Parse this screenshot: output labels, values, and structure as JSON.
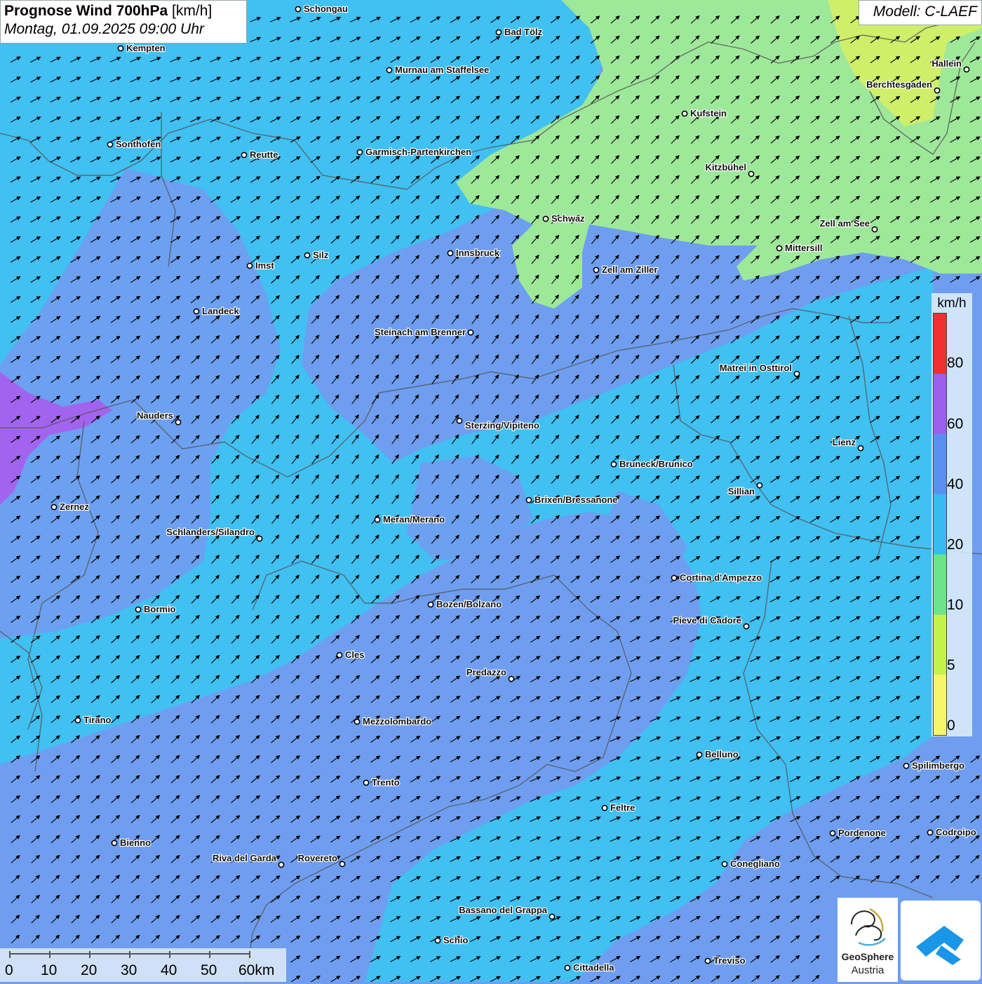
{
  "header": {
    "title_bold": "Prognose Wind 700hPa",
    "title_unit": " [km/h]",
    "datetime": "Montag, 01.09.2025 09:00 Uhr"
  },
  "model_label": "Modell: C-LAEF",
  "legend": {
    "unit": "km/h",
    "labels": [
      "80",
      "60",
      "40",
      "20",
      "10",
      "5",
      "0"
    ],
    "colors": {
      "c80_top": "#f03030",
      "c60_80": "#9a60ec",
      "c40_60": "#5a8ff0",
      "c20_40": "#35bdf0",
      "c10_20": "#6de38a",
      "c5_10": "#c4f24a",
      "c0_5": "#f7f56a"
    }
  },
  "scale": {
    "labels": [
      "0",
      "10",
      "20",
      "30",
      "40",
      "50",
      "60km"
    ]
  },
  "logos": {
    "geosphere_line1": "GeoSphere",
    "geosphere_line2": "Austria"
  },
  "map_colors": {
    "base_blue": "#6f9ef0",
    "cyan": "#41c0f2",
    "green": "#9ee89a",
    "yellow_green": "#cfef6a",
    "purple": "#a264ee",
    "border_line": "#555555",
    "wind_arrow": "#000000"
  },
  "cities": [
    {
      "name": "Schongau"
    },
    {
      "name": "Bad Tölz"
    },
    {
      "name": "Kempten"
    },
    {
      "name": "Murnau am Staffelsee"
    },
    {
      "name": "Hallein"
    },
    {
      "name": "Berchtesgaden"
    },
    {
      "name": "Kufstein"
    },
    {
      "name": "Sonthofen"
    },
    {
      "name": "Reutte"
    },
    {
      "name": "Garmisch-Partenkirchen"
    },
    {
      "name": "Kitzbühel"
    },
    {
      "name": "Schwaz"
    },
    {
      "name": "Zell am See"
    },
    {
      "name": "Mittersill"
    },
    {
      "name": "Innsbruck"
    },
    {
      "name": "Imst"
    },
    {
      "name": "Silz"
    },
    {
      "name": "Zell am Ziller"
    },
    {
      "name": "Landeck"
    },
    {
      "name": "Steinach am Brenner"
    },
    {
      "name": "Matrei in Osttirol"
    },
    {
      "name": "Nauders"
    },
    {
      "name": "Sterzing/Vipiteno"
    },
    {
      "name": "Lienz"
    },
    {
      "name": "Bruneck/Brunico"
    },
    {
      "name": "Sillian"
    },
    {
      "name": "Zernez"
    },
    {
      "name": "Brixen/Bressanone"
    },
    {
      "name": "Meran/Merano"
    },
    {
      "name": "Schlanders/Silandro"
    },
    {
      "name": "Cortina d'Ampezzo"
    },
    {
      "name": "Bozen/Bolzano"
    },
    {
      "name": "Bormio"
    },
    {
      "name": "Pieve di Cadore"
    },
    {
      "name": "Cles"
    },
    {
      "name": "Predazzo"
    },
    {
      "name": "Tirano"
    },
    {
      "name": "Mezzolombardo"
    },
    {
      "name": "Belluno"
    },
    {
      "name": "Spilimbergo"
    },
    {
      "name": "Trento"
    },
    {
      "name": "Feltre"
    },
    {
      "name": "Pordenone"
    },
    {
      "name": "Codroipo"
    },
    {
      "name": "Bienno"
    },
    {
      "name": "Riva del Garda"
    },
    {
      "name": "Rovereto"
    },
    {
      "name": "Conegliano"
    },
    {
      "name": "Bassano del Grappa"
    },
    {
      "name": "Schio"
    },
    {
      "name": "Treviso"
    },
    {
      "name": "Cittadella"
    }
  ]
}
